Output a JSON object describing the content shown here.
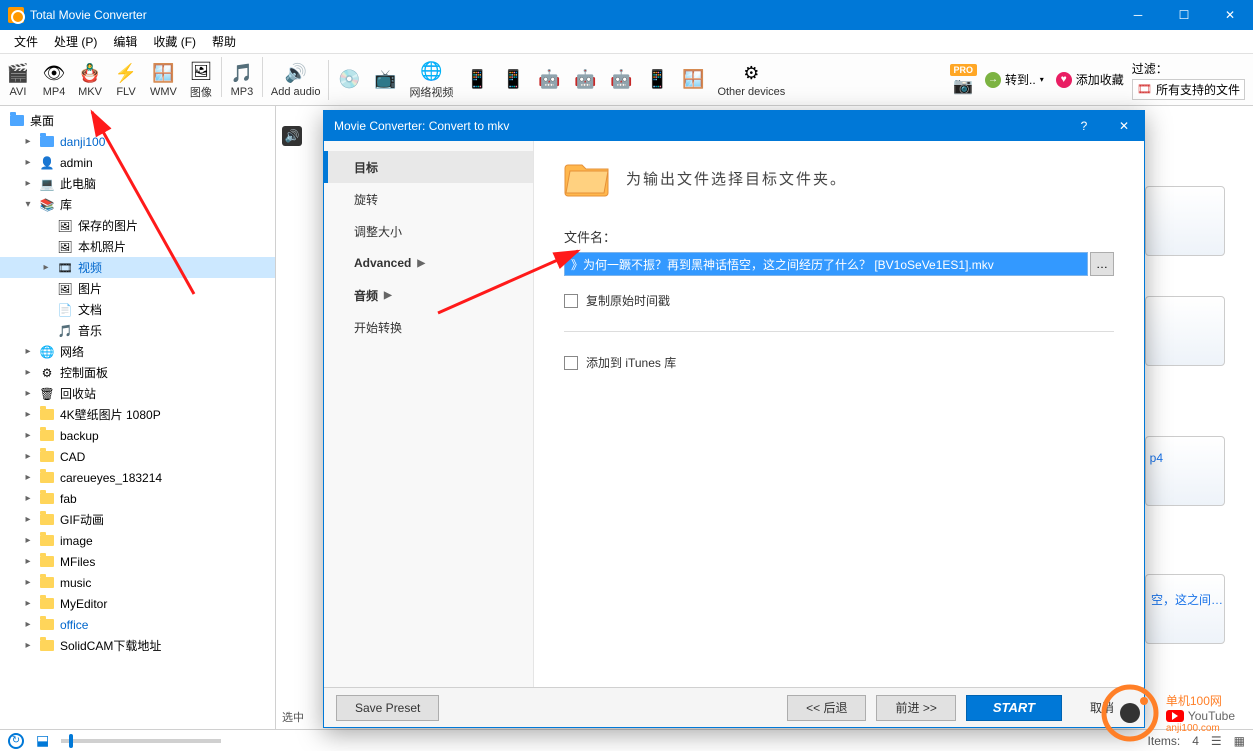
{
  "window": {
    "title": "Total Movie Converter"
  },
  "menu": [
    "文件",
    "处理 (P)",
    "编辑",
    "收藏 (F)",
    "帮助"
  ],
  "toolbar": {
    "formats": [
      {
        "label": "AVI",
        "em": "🎬"
      },
      {
        "label": "MP4",
        "em": "👁"
      },
      {
        "label": "MKV",
        "em": "🪆"
      },
      {
        "label": "FLV",
        "em": "⚡"
      },
      {
        "label": "WMV",
        "em": "🪟"
      },
      {
        "label": "图像",
        "em": "🖼"
      },
      {
        "label": "MP3",
        "em": "🎵"
      },
      {
        "label": "Add audio",
        "em": "🔊"
      }
    ],
    "devices": [
      {
        "label": "",
        "em": "💿"
      },
      {
        "label": "",
        "em": "📺"
      },
      {
        "label": "网络视频",
        "em": "🌐"
      },
      {
        "label": "",
        "em": "📱"
      },
      {
        "label": "",
        "em": "📱"
      },
      {
        "label": "",
        "em": "🤖"
      },
      {
        "label": "",
        "em": "🤖"
      },
      {
        "label": "",
        "em": "🤖"
      },
      {
        "label": "",
        "em": "📱"
      },
      {
        "label": "",
        "em": "🪟"
      },
      {
        "label": "Other devices",
        "em": "⚙"
      }
    ],
    "right": {
      "convert": "转到..",
      "fav": "添加收藏",
      "filter_label": "过滤：",
      "filter_value": "所有支持的文件"
    }
  },
  "tree": {
    "root": "桌面",
    "items": [
      {
        "i": 1,
        "c": "▸",
        "nm": "danji100",
        "blue": true,
        "ic": "folder-blue"
      },
      {
        "i": 1,
        "c": "▸",
        "nm": "admin",
        "ic": "user"
      },
      {
        "i": 1,
        "c": "▸",
        "nm": "此电脑",
        "ic": "pc"
      },
      {
        "i": 1,
        "c": "▾",
        "nm": "库",
        "ic": "lib"
      },
      {
        "i": 2,
        "c": "",
        "nm": "保存的图片",
        "ic": "img"
      },
      {
        "i": 2,
        "c": "",
        "nm": "本机照片",
        "ic": "img"
      },
      {
        "i": 2,
        "c": "▸",
        "nm": "视频",
        "blue": true,
        "sel": true,
        "ic": "vid"
      },
      {
        "i": 2,
        "c": "",
        "nm": "图片",
        "ic": "img"
      },
      {
        "i": 2,
        "c": "",
        "nm": "文档",
        "ic": "doc"
      },
      {
        "i": 2,
        "c": "",
        "nm": "音乐",
        "ic": "mus"
      },
      {
        "i": 1,
        "c": "▸",
        "nm": "网络",
        "ic": "net"
      },
      {
        "i": 1,
        "c": "▸",
        "nm": "控制面板",
        "ic": "ctrl"
      },
      {
        "i": 1,
        "c": "▸",
        "nm": "回收站",
        "ic": "bin"
      },
      {
        "i": 1,
        "c": "▸",
        "nm": "4K壁纸图片 1080P",
        "ic": "folder"
      },
      {
        "i": 1,
        "c": "▸",
        "nm": "backup",
        "ic": "folder"
      },
      {
        "i": 1,
        "c": "▸",
        "nm": "CAD",
        "ic": "folder"
      },
      {
        "i": 1,
        "c": "▸",
        "nm": "careueyes_183214",
        "ic": "folder"
      },
      {
        "i": 1,
        "c": "▸",
        "nm": "fab",
        "ic": "folder"
      },
      {
        "i": 1,
        "c": "▸",
        "nm": "GIF动画",
        "ic": "folder"
      },
      {
        "i": 1,
        "c": "▸",
        "nm": "image",
        "ic": "folder"
      },
      {
        "i": 1,
        "c": "▸",
        "nm": "MFiles",
        "ic": "folder"
      },
      {
        "i": 1,
        "c": "▸",
        "nm": "music",
        "ic": "folder"
      },
      {
        "i": 1,
        "c": "▸",
        "nm": "MyEditor",
        "ic": "folder"
      },
      {
        "i": 1,
        "c": "▸",
        "nm": "office",
        "blue": true,
        "ic": "folder"
      },
      {
        "i": 1,
        "c": "▸",
        "nm": "SolidCAM下载地址",
        "ic": "folder"
      }
    ]
  },
  "dialog": {
    "title": "Movie Converter:  Convert to mkv",
    "nav": [
      {
        "label": "目标",
        "active": true
      },
      {
        "label": "旋转"
      },
      {
        "label": "调整大小"
      },
      {
        "label": "Advanced",
        "arrow": true,
        "bold": true
      },
      {
        "label": "音频",
        "arrow": true,
        "bold": true
      },
      {
        "label": "开始转换"
      }
    ],
    "heading": "为输出文件选择目标文件夹。",
    "filename_label": "文件名：",
    "filename_value": "》为何一蹶不振？再到黑神话悟空，这之间经历了什么？ [BV1oSeVe1ES1].mkv",
    "chk1": "复制原始时间戳",
    "chk2": "添加到 iTunes 库",
    "foot": {
      "save": "Save Preset",
      "back": "<<  后退",
      "next": "前进  >>",
      "start": "START",
      "cancel": "取消"
    }
  },
  "status": {
    "items_label": "Items:",
    "items_value": "4",
    "selected": "选中"
  },
  "main_snippet": {
    "ext": "p4",
    "text": "空，这之间…"
  },
  "watermark": {
    "site": "单机100网",
    "url": "anji100.com"
  }
}
